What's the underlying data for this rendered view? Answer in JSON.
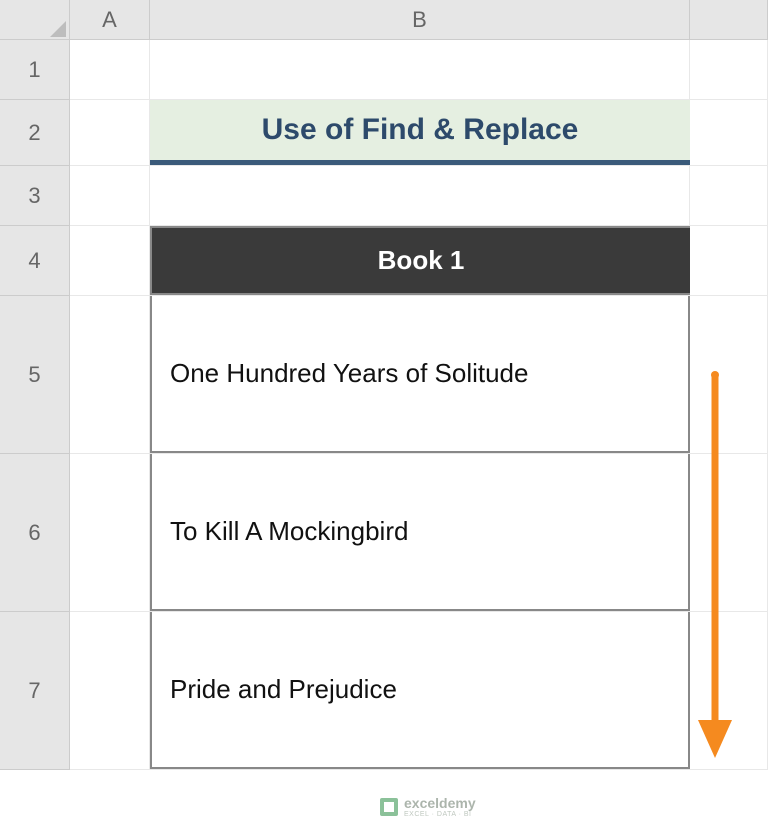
{
  "columns": {
    "A": "A",
    "B": "B"
  },
  "rows": {
    "r1": "1",
    "r2": "2",
    "r3": "3",
    "r4": "4",
    "r5": "5",
    "r6": "6",
    "r7": "7"
  },
  "title": "Use of Find & Replace",
  "table": {
    "header": "Book 1",
    "rows": [
      "One Hundred Years of Solitude",
      "To Kill A Mockingbird",
      "Pride and Prejudice"
    ]
  },
  "watermark": {
    "brand": "exceldemy",
    "tagline": "EXCEL · DATA · BI"
  },
  "colors": {
    "arrow": "#f58a1f"
  }
}
